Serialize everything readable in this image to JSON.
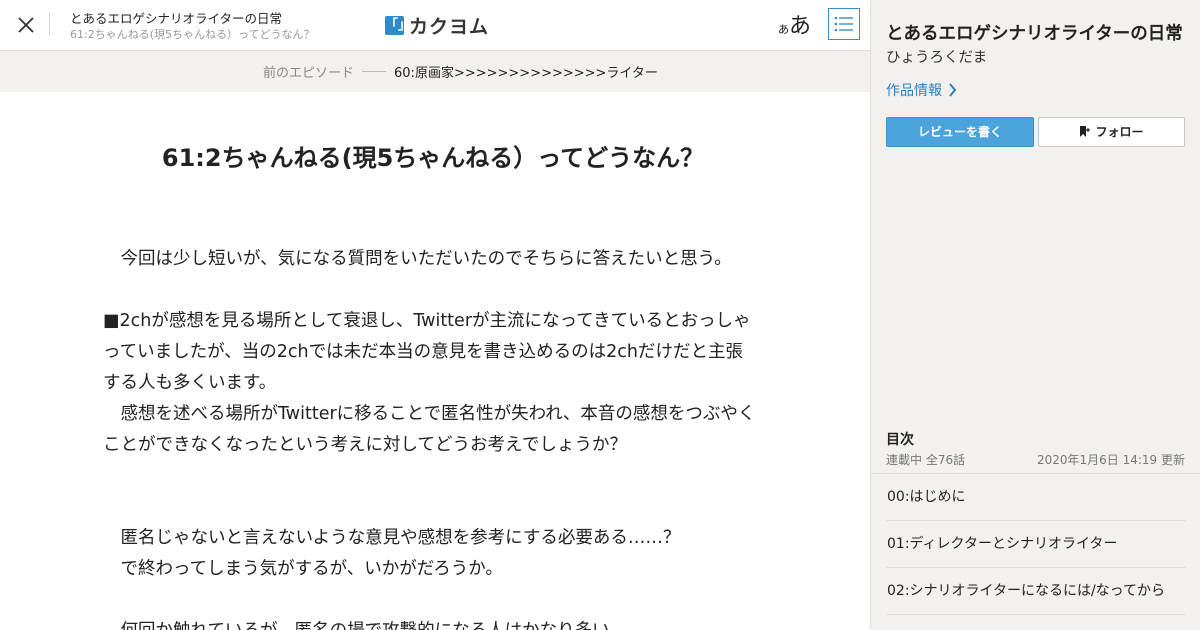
{
  "header": {
    "work_title": "とあるエロゲシナリオライターの日常",
    "episode_title": "61:2ちゃんねる(現5ちゃんねる）ってどうなん？",
    "logo_mark": "「」",
    "logo_text": "カクヨム",
    "font_size_small": "あ",
    "font_size_large": "あ",
    "icons": {
      "close": "close-icon",
      "toc": "list-icon"
    },
    "accent_color": "#2e8bc9"
  },
  "prev_episode": {
    "label": "前のエピソード",
    "title": "60:原画家>>>>>>>>>>>>>>ライター"
  },
  "episode": {
    "heading": "61:2ちゃんねる(現5ちゃんねる）ってどうなん？",
    "paragraphs": [
      "　今回は少し短いが、気になる質問をいただいたのでそちらに答えたいと思う。",
      "",
      "■2chが感想を見る場所として衰退し、Twitterが主流になってきているとおっしゃ",
      "っていましたが、当の2chでは未だ本当の意見を書き込めるのは2chだけだと主張",
      "する人も多くいます。",
      "　感想を述べる場所がTwitterに移ることで匿名性が失われ、本音の感想をつぶやく",
      "ことができなくなったという考えに対してどうお考えでしょうか？",
      "",
      "",
      "　匿名じゃないと言えないような意見や感想を参考にする必要ある……？",
      "　で終わってしまう気がするが、いかがだろうか。",
      "",
      "　何回か触れているが、匿名の場で攻撃的になる人はかなり多い"
    ]
  },
  "sidebar": {
    "title": "とあるエロゲシナリオライターの日常",
    "author": "ひょうろくだま",
    "work_info": "作品情報",
    "review_button": "レビューを書く",
    "follow_button": "フォロー",
    "toc_label": "目次",
    "toc_status": "連載中 全76話",
    "toc_updated": "2020年1月6日 14:19 更新",
    "toc_items": [
      "00:はじめに",
      "01:ディレクターとシナリオライター",
      "02:シナリオライターになるには/なってから"
    ],
    "button_color": "#4ba3dc"
  }
}
